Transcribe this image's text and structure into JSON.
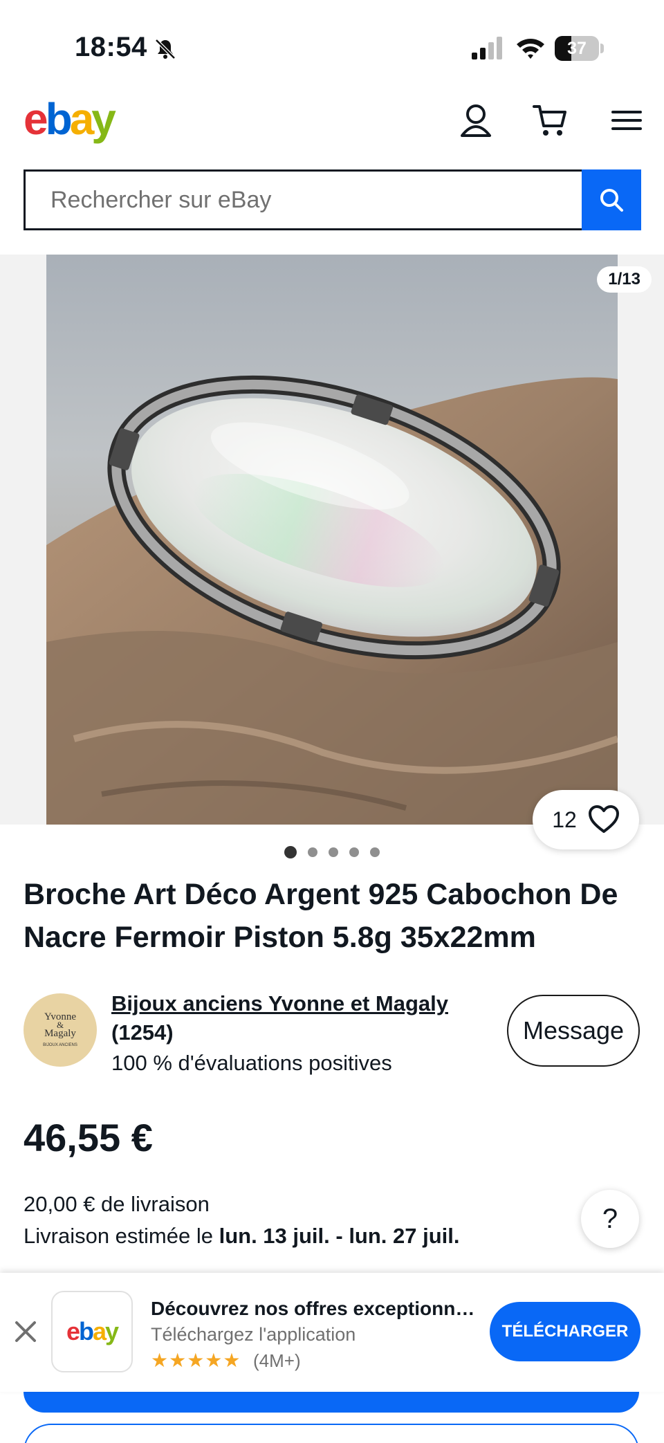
{
  "status_bar": {
    "time": "18:54",
    "battery_level": "37",
    "icons": [
      "bell-slash-icon",
      "signal-icon",
      "wifi-icon",
      "battery-icon"
    ]
  },
  "header": {
    "logo_letters": [
      "e",
      "b",
      "a",
      "y"
    ],
    "logo_colors": [
      "#e53238",
      "#0064d2",
      "#f5af02",
      "#86b817"
    ],
    "icons": [
      "account-icon",
      "cart-icon",
      "menu-icon"
    ]
  },
  "search": {
    "placeholder": "Rechercher sur eBay"
  },
  "gallery": {
    "counter": "1/13",
    "watch_count": "12",
    "total_dots": 5,
    "active_dot": 0
  },
  "item": {
    "title": "Broche Art Déco Argent 925 Cabochon De Nacre Fermoir Piston 5.8g 35x22mm"
  },
  "seller": {
    "avatar_text": [
      "Yvonne",
      "&",
      "Magaly",
      "BIJOUX ANCIENS"
    ],
    "name": "Bijoux anciens Yvonne et Magaly",
    "feedback_count": "(1254)",
    "rating": "100 % d'évaluations positives",
    "message_label": "Message"
  },
  "pricing": {
    "price": "46,55 €",
    "shipping": "20,00 € de livraison",
    "delivery_prefix": "Livraison estimée le ",
    "delivery_dates": "lun. 13 juil. - lun. 27 juil."
  },
  "help": {
    "label": "?"
  },
  "app_banner": {
    "title": "Découvrez nos offres exceptionnelles",
    "subtitle": "Téléchargez l'application",
    "stars": "★★★★★",
    "reviews": "(4M+)",
    "download_label": "TÉLÉCHARGER",
    "logo_text": [
      "e",
      "b",
      "a",
      "y"
    ]
  },
  "colors": {
    "accent": "#0968f6",
    "text": "#111820",
    "muted": "#707070",
    "star": "#f5a623"
  }
}
